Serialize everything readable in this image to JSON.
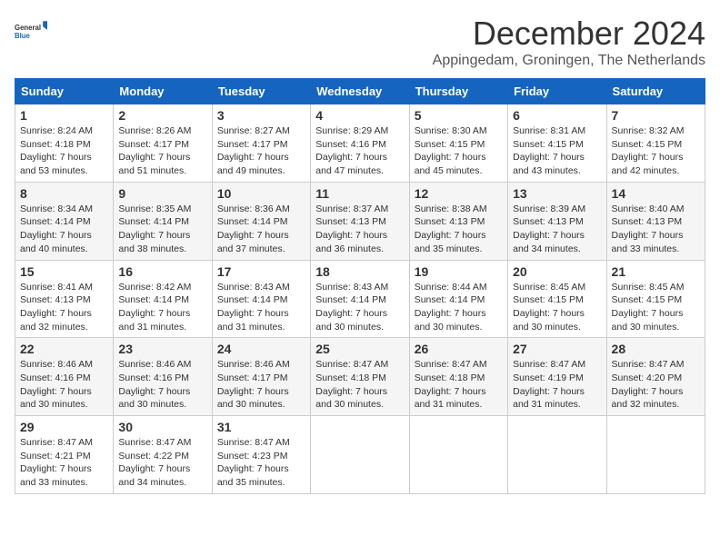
{
  "logo": {
    "general": "General",
    "blue": "Blue"
  },
  "title": "December 2024",
  "subtitle": "Appingedam, Groningen, The Netherlands",
  "days_of_week": [
    "Sunday",
    "Monday",
    "Tuesday",
    "Wednesday",
    "Thursday",
    "Friday",
    "Saturday"
  ],
  "weeks": [
    [
      {
        "day": 1,
        "sunrise": "8:24 AM",
        "sunset": "4:18 PM",
        "daylight": "7 hours and 53 minutes."
      },
      {
        "day": 2,
        "sunrise": "8:26 AM",
        "sunset": "4:17 PM",
        "daylight": "7 hours and 51 minutes."
      },
      {
        "day": 3,
        "sunrise": "8:27 AM",
        "sunset": "4:17 PM",
        "daylight": "7 hours and 49 minutes."
      },
      {
        "day": 4,
        "sunrise": "8:29 AM",
        "sunset": "4:16 PM",
        "daylight": "7 hours and 47 minutes."
      },
      {
        "day": 5,
        "sunrise": "8:30 AM",
        "sunset": "4:15 PM",
        "daylight": "7 hours and 45 minutes."
      },
      {
        "day": 6,
        "sunrise": "8:31 AM",
        "sunset": "4:15 PM",
        "daylight": "7 hours and 43 minutes."
      },
      {
        "day": 7,
        "sunrise": "8:32 AM",
        "sunset": "4:15 PM",
        "daylight": "7 hours and 42 minutes."
      }
    ],
    [
      {
        "day": 8,
        "sunrise": "8:34 AM",
        "sunset": "4:14 PM",
        "daylight": "7 hours and 40 minutes."
      },
      {
        "day": 9,
        "sunrise": "8:35 AM",
        "sunset": "4:14 PM",
        "daylight": "7 hours and 38 minutes."
      },
      {
        "day": 10,
        "sunrise": "8:36 AM",
        "sunset": "4:14 PM",
        "daylight": "7 hours and 37 minutes."
      },
      {
        "day": 11,
        "sunrise": "8:37 AM",
        "sunset": "4:13 PM",
        "daylight": "7 hours and 36 minutes."
      },
      {
        "day": 12,
        "sunrise": "8:38 AM",
        "sunset": "4:13 PM",
        "daylight": "7 hours and 35 minutes."
      },
      {
        "day": 13,
        "sunrise": "8:39 AM",
        "sunset": "4:13 PM",
        "daylight": "7 hours and 34 minutes."
      },
      {
        "day": 14,
        "sunrise": "8:40 AM",
        "sunset": "4:13 PM",
        "daylight": "7 hours and 33 minutes."
      }
    ],
    [
      {
        "day": 15,
        "sunrise": "8:41 AM",
        "sunset": "4:13 PM",
        "daylight": "7 hours and 32 minutes."
      },
      {
        "day": 16,
        "sunrise": "8:42 AM",
        "sunset": "4:14 PM",
        "daylight": "7 hours and 31 minutes."
      },
      {
        "day": 17,
        "sunrise": "8:43 AM",
        "sunset": "4:14 PM",
        "daylight": "7 hours and 31 minutes."
      },
      {
        "day": 18,
        "sunrise": "8:43 AM",
        "sunset": "4:14 PM",
        "daylight": "7 hours and 30 minutes."
      },
      {
        "day": 19,
        "sunrise": "8:44 AM",
        "sunset": "4:14 PM",
        "daylight": "7 hours and 30 minutes."
      },
      {
        "day": 20,
        "sunrise": "8:45 AM",
        "sunset": "4:15 PM",
        "daylight": "7 hours and 30 minutes."
      },
      {
        "day": 21,
        "sunrise": "8:45 AM",
        "sunset": "4:15 PM",
        "daylight": "7 hours and 30 minutes."
      }
    ],
    [
      {
        "day": 22,
        "sunrise": "8:46 AM",
        "sunset": "4:16 PM",
        "daylight": "7 hours and 30 minutes."
      },
      {
        "day": 23,
        "sunrise": "8:46 AM",
        "sunset": "4:16 PM",
        "daylight": "7 hours and 30 minutes."
      },
      {
        "day": 24,
        "sunrise": "8:46 AM",
        "sunset": "4:17 PM",
        "daylight": "7 hours and 30 minutes."
      },
      {
        "day": 25,
        "sunrise": "8:47 AM",
        "sunset": "4:18 PM",
        "daylight": "7 hours and 30 minutes."
      },
      {
        "day": 26,
        "sunrise": "8:47 AM",
        "sunset": "4:18 PM",
        "daylight": "7 hours and 31 minutes."
      },
      {
        "day": 27,
        "sunrise": "8:47 AM",
        "sunset": "4:19 PM",
        "daylight": "7 hours and 31 minutes."
      },
      {
        "day": 28,
        "sunrise": "8:47 AM",
        "sunset": "4:20 PM",
        "daylight": "7 hours and 32 minutes."
      }
    ],
    [
      {
        "day": 29,
        "sunrise": "8:47 AM",
        "sunset": "4:21 PM",
        "daylight": "7 hours and 33 minutes."
      },
      {
        "day": 30,
        "sunrise": "8:47 AM",
        "sunset": "4:22 PM",
        "daylight": "7 hours and 34 minutes."
      },
      {
        "day": 31,
        "sunrise": "8:47 AM",
        "sunset": "4:23 PM",
        "daylight": "7 hours and 35 minutes."
      },
      null,
      null,
      null,
      null
    ]
  ],
  "labels": {
    "sunrise": "Sunrise:",
    "sunset": "Sunset:",
    "daylight": "Daylight:"
  }
}
